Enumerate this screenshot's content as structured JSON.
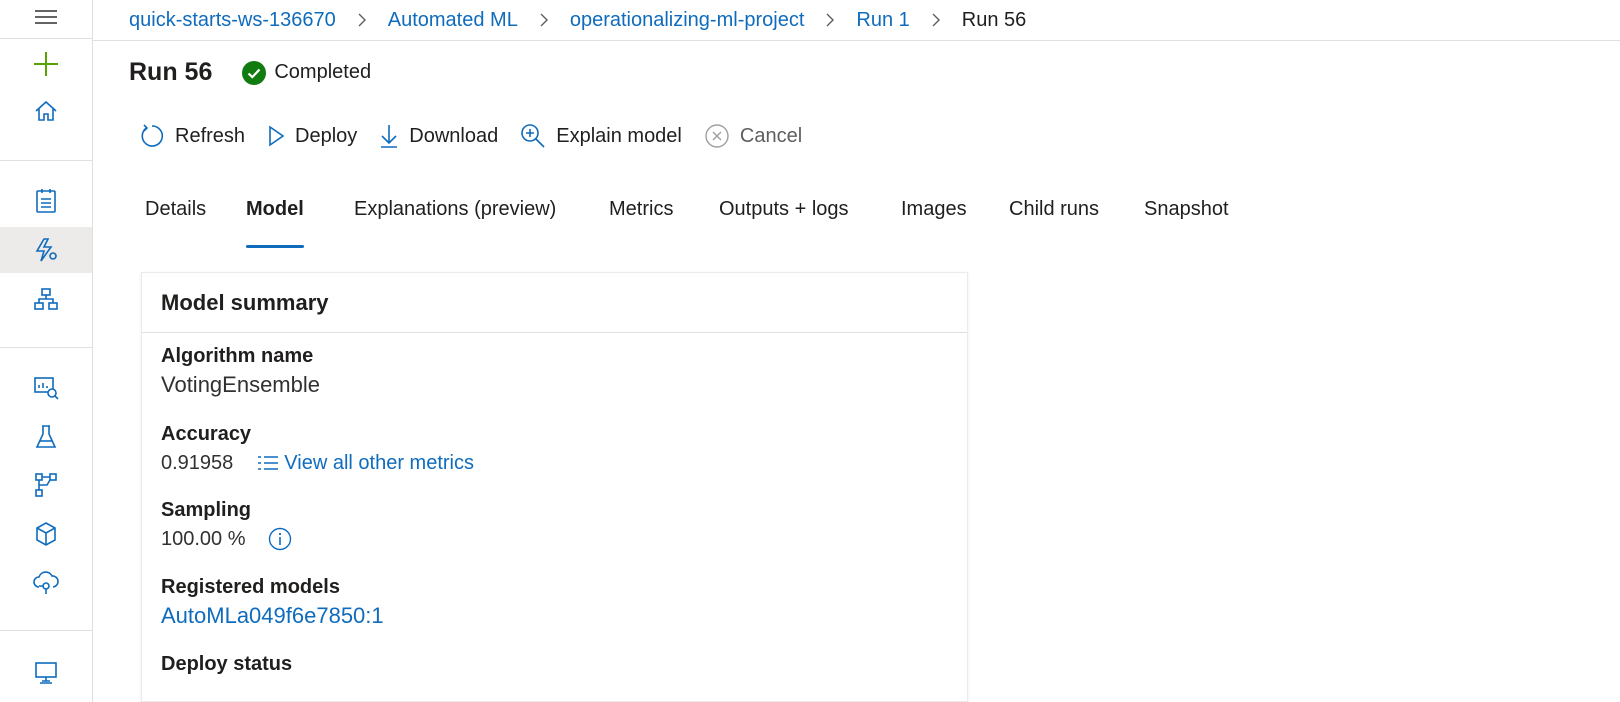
{
  "breadcrumb": {
    "items": [
      "quick-starts-ws-136670",
      "Automated ML",
      "operationalizing-ml-project",
      "Run 1",
      "Run 56"
    ]
  },
  "page": {
    "title": "Run 56",
    "status": "Completed",
    "status_color": "#107c10"
  },
  "toolbar": {
    "refresh": "Refresh",
    "deploy": "Deploy",
    "download": "Download",
    "explain": "Explain model",
    "cancel": "Cancel"
  },
  "tabs": {
    "items": [
      "Details",
      "Model",
      "Explanations (preview)",
      "Metrics",
      "Outputs + logs",
      "Images",
      "Child runs",
      "Snapshot"
    ],
    "active": "Model"
  },
  "model_summary": {
    "heading": "Model summary",
    "algorithm_label": "Algorithm name",
    "algorithm_value": "VotingEnsemble",
    "accuracy_label": "Accuracy",
    "accuracy_value": "0.91958",
    "metrics_link": "View all other metrics",
    "sampling_label": "Sampling",
    "sampling_value": "100.00 %",
    "registered_label": "Registered models",
    "registered_value": "AutoMLa049f6e7850:1",
    "deploy_label": "Deploy status"
  },
  "colors": {
    "accent": "#0f6cbd",
    "add_green": "#57a300"
  },
  "rail_icons": [
    "hamburger-menu-icon",
    "plus-icon",
    "home-icon",
    "notebook-icon",
    "automl-icon",
    "designer-icon",
    "datasets-icon",
    "experiments-icon",
    "pipelines-icon",
    "models-icon",
    "endpoints-icon",
    "compute-icon"
  ]
}
